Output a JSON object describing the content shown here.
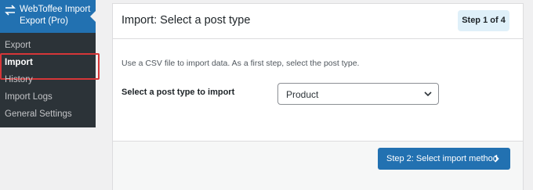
{
  "sidebar": {
    "plugin_title": "WebToffee Import Export (Pro)",
    "items": [
      {
        "label": "Export"
      },
      {
        "label": "Import"
      },
      {
        "label": "History"
      },
      {
        "label": "Import Logs"
      },
      {
        "label": "General Settings"
      }
    ]
  },
  "panel": {
    "title": "Import: Select a post type",
    "step_badge": "Step 1 of 4",
    "intro": "Use a CSV file to import data. As a first step, select the post type.",
    "field_label": "Select a post type to import",
    "selected_value": "Product",
    "next_button": "Step 2: Select import method"
  },
  "colors": {
    "sidebar_bg": "#2c3338",
    "sidebar_active_bg": "#2271b1",
    "highlight_border": "#d63638",
    "primary_button": "#2271b1",
    "badge_bg": "#dff0f9"
  }
}
